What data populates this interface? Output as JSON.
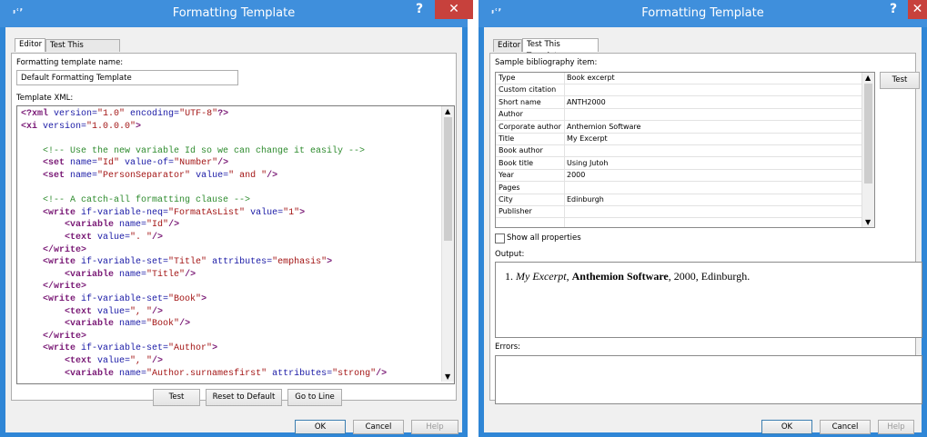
{
  "left_window": {
    "app_icon": "יʿʼ",
    "title": "Formatting Template",
    "help_glyph": "?",
    "close_glyph": "✕",
    "tabs": [
      "Editor",
      "Test This Template"
    ],
    "name_label": "Formatting template name:",
    "name_value": "Default Formatting Template",
    "xml_label": "Template XML:",
    "buttons": {
      "test": "Test",
      "reset": "Reset to Default",
      "goto": "Go to Line"
    },
    "footer": {
      "ok": "OK",
      "cancel": "Cancel",
      "help": "Help"
    }
  },
  "xml_lines": [
    [
      [
        "kw",
        "<?xml"
      ],
      [
        "attr",
        " version="
      ],
      [
        "val",
        "\"1.0\""
      ],
      [
        "attr",
        " encoding="
      ],
      [
        "val",
        "\"UTF-8\""
      ],
      [
        "kw",
        "?>"
      ]
    ],
    [
      [
        "kw",
        "<xi"
      ],
      [
        "attr",
        " version="
      ],
      [
        "val",
        "\"1.0.0.0\""
      ],
      [
        "kw",
        ">"
      ]
    ],
    [],
    [
      [
        "cmt",
        "    <!-- Use the new variable Id so we can change it easily -->"
      ]
    ],
    [
      [
        "kw",
        "    <set"
      ],
      [
        "attr",
        " name="
      ],
      [
        "val",
        "\"Id\""
      ],
      [
        "attr",
        " value-of="
      ],
      [
        "val",
        "\"Number\""
      ],
      [
        "kw",
        "/>"
      ]
    ],
    [
      [
        "kw",
        "    <set"
      ],
      [
        "attr",
        " name="
      ],
      [
        "val",
        "\"PersonSeparator\""
      ],
      [
        "attr",
        " value="
      ],
      [
        "val",
        "\" and \""
      ],
      [
        "kw",
        "/>"
      ]
    ],
    [],
    [
      [
        "cmt",
        "    <!-- A catch-all formatting clause -->"
      ]
    ],
    [
      [
        "kw",
        "    <write"
      ],
      [
        "attr",
        " if-variable-neq="
      ],
      [
        "val",
        "\"FormatAsList\""
      ],
      [
        "attr",
        " value="
      ],
      [
        "val",
        "\"1\""
      ],
      [
        "kw",
        ">"
      ]
    ],
    [
      [
        "kw",
        "        <variable"
      ],
      [
        "attr",
        " name="
      ],
      [
        "val",
        "\"Id\""
      ],
      [
        "kw",
        "/>"
      ]
    ],
    [
      [
        "kw",
        "        <text"
      ],
      [
        "attr",
        " value="
      ],
      [
        "val",
        "\". \""
      ],
      [
        "kw",
        "/>"
      ]
    ],
    [
      [
        "kw",
        "    </write>"
      ]
    ],
    [
      [
        "kw",
        "    <write"
      ],
      [
        "attr",
        " if-variable-set="
      ],
      [
        "val",
        "\"Title\""
      ],
      [
        "attr",
        " attributes="
      ],
      [
        "val",
        "\"emphasis\""
      ],
      [
        "kw",
        ">"
      ]
    ],
    [
      [
        "kw",
        "        <variable"
      ],
      [
        "attr",
        " name="
      ],
      [
        "val",
        "\"Title\""
      ],
      [
        "kw",
        "/>"
      ]
    ],
    [
      [
        "kw",
        "    </write>"
      ]
    ],
    [
      [
        "kw",
        "    <write"
      ],
      [
        "attr",
        " if-variable-set="
      ],
      [
        "val",
        "\"Book\""
      ],
      [
        "kw",
        ">"
      ]
    ],
    [
      [
        "kw",
        "        <text"
      ],
      [
        "attr",
        " value="
      ],
      [
        "val",
        "\", \""
      ],
      [
        "kw",
        "/>"
      ]
    ],
    [
      [
        "kw",
        "        <variable"
      ],
      [
        "attr",
        " name="
      ],
      [
        "val",
        "\"Book\""
      ],
      [
        "kw",
        "/>"
      ]
    ],
    [
      [
        "kw",
        "    </write>"
      ]
    ],
    [
      [
        "kw",
        "    <write"
      ],
      [
        "attr",
        " if-variable-set="
      ],
      [
        "val",
        "\"Author\""
      ],
      [
        "kw",
        ">"
      ]
    ],
    [
      [
        "kw",
        "        <text"
      ],
      [
        "attr",
        " value="
      ],
      [
        "val",
        "\", \""
      ],
      [
        "kw",
        "/>"
      ]
    ],
    [
      [
        "kw",
        "        <variable"
      ],
      [
        "attr",
        " name="
      ],
      [
        "val",
        "\"Author.surnamesfirst\""
      ],
      [
        "attr",
        " attributes="
      ],
      [
        "val",
        "\"strong\""
      ],
      [
        "kw",
        "/>"
      ]
    ]
  ],
  "right_window": {
    "app_icon": "יʿʼ",
    "title": "Formatting Template",
    "help_glyph": "?",
    "close_glyph": "✕",
    "tabs": [
      "Editor",
      "Test This Template"
    ],
    "sample_label": "Sample bibliography item:",
    "test_button": "Test",
    "properties": [
      {
        "name": "Type",
        "value": "Book excerpt"
      },
      {
        "name": "Custom citation",
        "value": ""
      },
      {
        "name": "Short name",
        "value": "ANTH2000"
      },
      {
        "name": "Author",
        "value": ""
      },
      {
        "name": "Corporate author",
        "value": "Anthemion Software"
      },
      {
        "name": "Title",
        "value": "My Excerpt"
      },
      {
        "name": "Book author",
        "value": ""
      },
      {
        "name": "Book title",
        "value": "Using Jutoh"
      },
      {
        "name": "Year",
        "value": "2000"
      },
      {
        "name": "Pages",
        "value": ""
      },
      {
        "name": "City",
        "value": "Edinburgh"
      },
      {
        "name": "Publisher",
        "value": ""
      }
    ],
    "show_all_label": "Show all properties",
    "output_label": "Output:",
    "output": {
      "num": "1.",
      "title": "My Excerpt",
      "sep1": ", ",
      "author": "Anthemion Software",
      "rest": ", 2000, Edinburgh."
    },
    "errors_label": "Errors:",
    "footer": {
      "ok": "OK",
      "cancel": "Cancel",
      "help": "Help"
    }
  },
  "colors": {
    "titlebar": "#3f8fdc",
    "border": "#2f86d6",
    "close": "#c7413c"
  }
}
